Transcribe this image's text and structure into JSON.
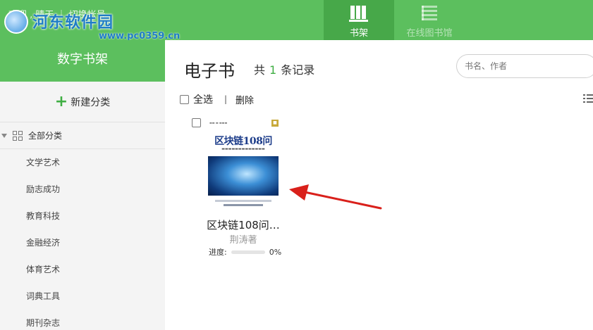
{
  "header": {
    "user_text": "欢迎 , 晴天 ｜ 切换帐号",
    "watermark_name": "河东软件园",
    "watermark_url": "www.pc0359.cn",
    "tabs": [
      {
        "label": "书架",
        "active": true,
        "icon": "bookshelf-icon"
      },
      {
        "label": "在线图书馆",
        "active": false,
        "icon": "library-icon"
      }
    ]
  },
  "sidebar": {
    "title": "数字书架",
    "new_category_label": "新建分类",
    "all_category_label": "全部分类",
    "categories": [
      "文学艺术",
      "励志成功",
      "教育科技",
      "金融经济",
      "体育艺术",
      "词典工具",
      "期刊杂志"
    ]
  },
  "main": {
    "title": "电子书",
    "record_prefix": "共",
    "record_count": "1",
    "record_suffix": "条记录",
    "search_placeholder": "书名、作者",
    "select_all_label": "全选",
    "separator": "|",
    "delete_label": "删除"
  },
  "books": [
    {
      "cover_title": "区块链108问",
      "title": "区块链108问…",
      "author": "荆涛著",
      "progress_label": "进度:",
      "progress": 0,
      "progress_text": "0%"
    }
  ],
  "colors": {
    "header_green": "#5cbf5e",
    "active_tab_green": "#47a849",
    "count_green": "#3fae43",
    "arrow_red": "#d9201b"
  }
}
